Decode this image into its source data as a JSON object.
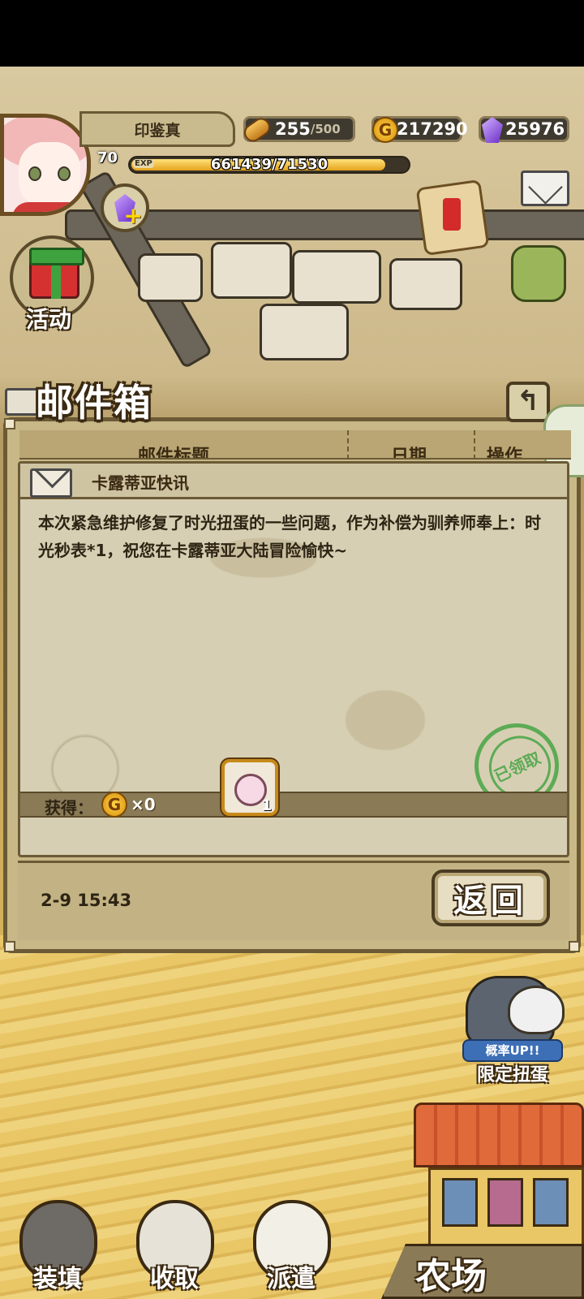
{
  "player": {
    "name": "印鉴真",
    "level": "70",
    "exp_label": "EXP",
    "exp_text": "661439/71530",
    "exp_progress": 0.92
  },
  "resources": {
    "stamina": {
      "value": "255",
      "max": "/500",
      "icon": "bread-icon"
    },
    "gold": {
      "value": "217290",
      "icon": "gold-coin-icon",
      "glyph": "G"
    },
    "gems": {
      "value": "25976",
      "icon": "purple-gem-icon"
    }
  },
  "side_buttons": {
    "event_label": "活动"
  },
  "mailbox": {
    "title": "邮件箱",
    "back_glyph": "↰",
    "columns": [
      "邮件标题",
      "日期",
      "操作"
    ],
    "mail": {
      "subject": "卡露蒂亚快讯",
      "body": "本次紧急维护修复了时光扭蛋的一些问题，作为补偿为驯养师奉上：时光秒表*1，祝您在卡露蒂亚大陆冒险愉快~",
      "stamp_text": "已领取",
      "reward_label": "获得：",
      "reward_coin_glyph": "G",
      "reward_coin_count": "×0",
      "reward_item_count": "1",
      "date": "2-9 15:43",
      "return_label": "返回"
    }
  },
  "gacha": {
    "tag": "概率UP!!",
    "label": "限定扭蛋"
  },
  "bottom_nav": {
    "load_label": "装填",
    "collect_label": "收取",
    "dispatch_label": "派遣",
    "farm_label": "农场"
  },
  "colors": {
    "panel": "#c8b887",
    "frame": "#6b5a35",
    "stamp_green": "#3ea33e",
    "exp_fill": "#e6a21c"
  }
}
